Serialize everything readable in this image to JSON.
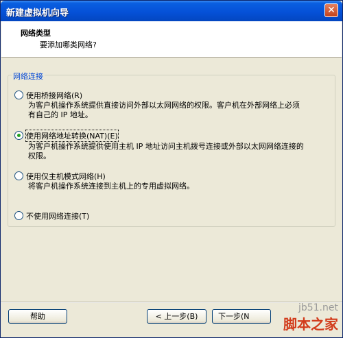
{
  "window": {
    "title": "新建虚拟机向导",
    "close_glyph": "✕"
  },
  "header": {
    "title": "网络类型",
    "subtitle": "要添加哪类网络?"
  },
  "group": {
    "legend": "网络连接",
    "options": [
      {
        "label": "使用桥接网络(R)",
        "checked": false,
        "desc_line1": "为客户机操作系统提供直接访问外部以太网网络的权限。客户机在外部网络上必须",
        "desc_line2": "有自己的 IP 地址。"
      },
      {
        "label": "使用网络地址转换(NAT)(E)",
        "checked": true,
        "desc_line1": "为客户机操作系统提供使用主机 IP 地址访问主机拨号连接或外部以太网网络连接的",
        "desc_line2": "权限。"
      },
      {
        "label": "使用仅主机模式网络(H)",
        "checked": false,
        "desc_line1": "将客户机操作系统连接到主机上的专用虚拟网络。"
      },
      {
        "label": "不使用网络连接(T)",
        "checked": false
      }
    ]
  },
  "buttons": {
    "help": "帮助",
    "back": "< 上一步(B)",
    "next": "下一步(N"
  },
  "watermark": {
    "site": "jb51.net",
    "brand": "脚本之家"
  }
}
